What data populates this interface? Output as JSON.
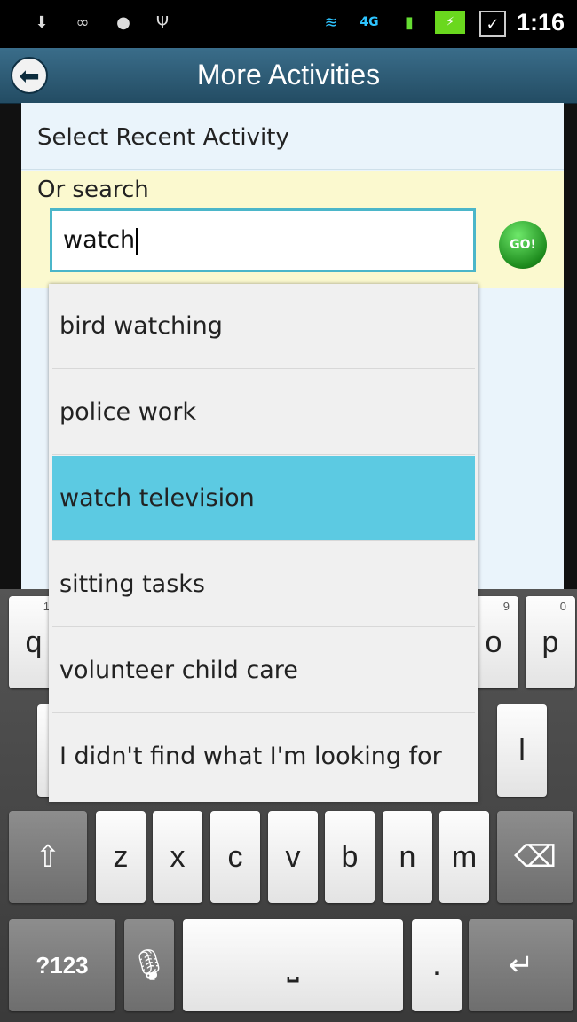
{
  "status_bar": {
    "time": "1:16"
  },
  "header": {
    "title": "More Activities"
  },
  "recent": {
    "label": "Select Recent Activity"
  },
  "search": {
    "label": "Or search",
    "value": "watch",
    "go_label": "GO!"
  },
  "suggestions": [
    {
      "label": "bird watching",
      "selected": false
    },
    {
      "label": "police work",
      "selected": false
    },
    {
      "label": "watch television",
      "selected": true
    },
    {
      "label": "sitting tasks",
      "selected": false
    },
    {
      "label": "volunteer child care",
      "selected": false
    },
    {
      "label": "I didn't find what I'm looking for",
      "selected": false
    }
  ],
  "keyboard": {
    "row1_visible": [
      "q",
      "o",
      "p"
    ],
    "row1_numbers": [
      "1",
      "9",
      "0"
    ],
    "row2_visible": [
      "l"
    ],
    "row3": [
      "z",
      "x",
      "c",
      "v",
      "b",
      "n",
      "m"
    ],
    "symbols_label": "?123",
    "period_label": "."
  },
  "colors": {
    "selected_row": "#5ccae2",
    "search_border": "#4bb6c9",
    "search_bg": "#fbf9cf"
  }
}
